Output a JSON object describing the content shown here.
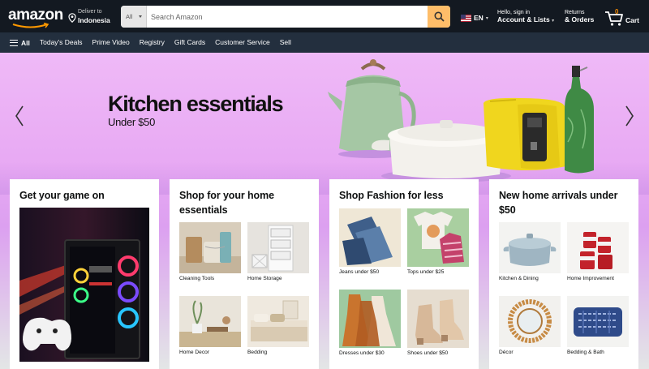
{
  "header": {
    "logo": "amazon",
    "deliver_line1": "Deliver to",
    "deliver_line2": "Indonesia",
    "search_category": "All",
    "search_placeholder": "Search Amazon",
    "language": "EN",
    "account_line1": "Hello, sign in",
    "account_line2": "Account & Lists",
    "orders_line1": "Returns",
    "orders_line2": "& Orders",
    "cart_count": "0",
    "cart_label": "Cart"
  },
  "nav": {
    "all_label": "All",
    "links": [
      "Today's Deals",
      "Prime Video",
      "Registry",
      "Gift Cards",
      "Customer Service",
      "Sell"
    ]
  },
  "hero": {
    "title": "Kitchen essentials",
    "subtitle": "Under $50"
  },
  "cards": [
    {
      "title": "Get your game on"
    },
    {
      "title": "Shop for your home essentials",
      "tiles": [
        "Cleaning Tools",
        "Home Storage",
        "Home Decor",
        "Bedding"
      ]
    },
    {
      "title": "Shop Fashion for less",
      "tiles": [
        "Jeans under $50",
        "Tops under $25",
        "Dresses under $30",
        "Shoes under $50"
      ]
    },
    {
      "title": "New home arrivals under $50",
      "tiles": [
        "Kitchen & Dining",
        "Home Improvement",
        "Décor",
        "Bedding & Bath"
      ]
    }
  ],
  "colors": {
    "header_bg": "#131921",
    "nav_bg": "#232f3e",
    "search_button": "#febd69",
    "cart_count": "#f08804",
    "hero_bg": "#e7a8f3"
  }
}
